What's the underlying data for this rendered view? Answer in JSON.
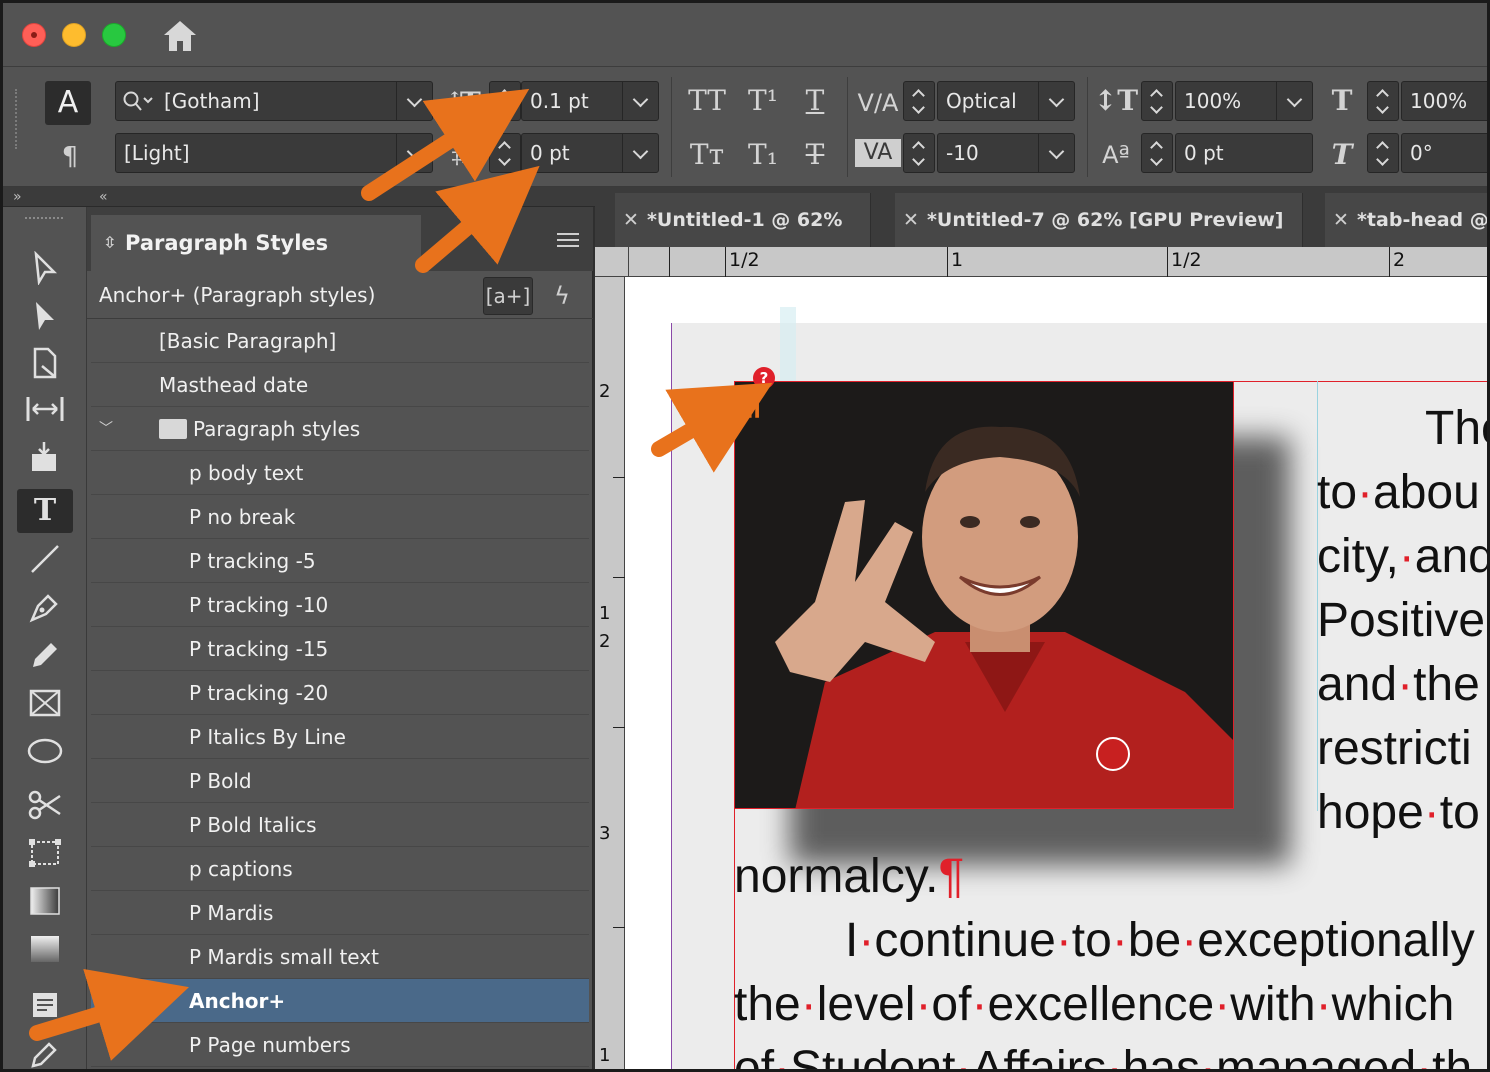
{
  "window": {
    "home_icon": "home-icon"
  },
  "control_panel": {
    "character_mode_glyph": "A",
    "paragraph_mode_glyph": "¶",
    "font_family": "[Gotham]",
    "font_style": "[Light]",
    "font_size": "0.1 pt",
    "leading": "0 pt",
    "kerning": "Optical",
    "tracking": "-10",
    "vertical_scale": "100%",
    "horizontal_scale": "100%",
    "baseline_shift": "0 pt",
    "skew": "0°",
    "allcaps_glyph": "TT",
    "superscript_glyph": "T¹",
    "underline_glyph": "T",
    "smallcaps_glyph": "Tт",
    "subscript_glyph": "T₁",
    "strikethrough_glyph": "T"
  },
  "collapse": {
    "left": "»",
    "right": "«"
  },
  "paragraph_styles_panel": {
    "title": "Paragraph Styles",
    "breadcrumb": "Anchor+ (Paragraph styles)",
    "new_style_button": "[a+]",
    "items": [
      {
        "label": "[Basic Paragraph]",
        "indent": 1
      },
      {
        "label": "Masthead date",
        "indent": 1
      },
      {
        "label": "Paragraph styles",
        "indent": 1,
        "folder": true
      },
      {
        "label": "p body text",
        "indent": 2
      },
      {
        "label": "P no break",
        "indent": 2
      },
      {
        "label": "P tracking -5",
        "indent": 2
      },
      {
        "label": "P tracking -10",
        "indent": 2
      },
      {
        "label": "P tracking -15",
        "indent": 2
      },
      {
        "label": "P tracking -20",
        "indent": 2
      },
      {
        "label": "P Italics By Line",
        "indent": 2
      },
      {
        "label": "P Bold",
        "indent": 2
      },
      {
        "label": "P Bold Italics",
        "indent": 2
      },
      {
        "label": "p captions",
        "indent": 2
      },
      {
        "label": "P Mardis",
        "indent": 2
      },
      {
        "label": "P Mardis small text",
        "indent": 2
      },
      {
        "label": "Anchor+",
        "indent": 2,
        "selected": true
      },
      {
        "label": "P Page numbers",
        "indent": 2
      }
    ]
  },
  "doc_tabs": [
    {
      "label": "*Untitled-1 @ 62%"
    },
    {
      "label": "*Untitled-7 @ 62% [GPU Preview]"
    },
    {
      "label": "*tab-head @"
    }
  ],
  "rulers": {
    "horizontal": [
      "1/2",
      "1",
      "1/2",
      "2"
    ],
    "vertical": [
      "2",
      "1",
      "2",
      "3",
      "1"
    ]
  },
  "document_text": {
    "right_column": [
      "The",
      "to·abou",
      "city,·and",
      "Positive",
      "and·the",
      "restricti",
      "hope·to"
    ],
    "line_normalcy": "normalcy.",
    "line_continue": "I·continue·to·be·exceptionally",
    "line_level": "the·level·of·excellence·with·which",
    "line_partial": "of·Student·Affairs·has·managed·th"
  },
  "colors": {
    "accent_orange": "#e8721c",
    "selection_blue": "#4a6989",
    "frame_red": "#e0202a"
  }
}
